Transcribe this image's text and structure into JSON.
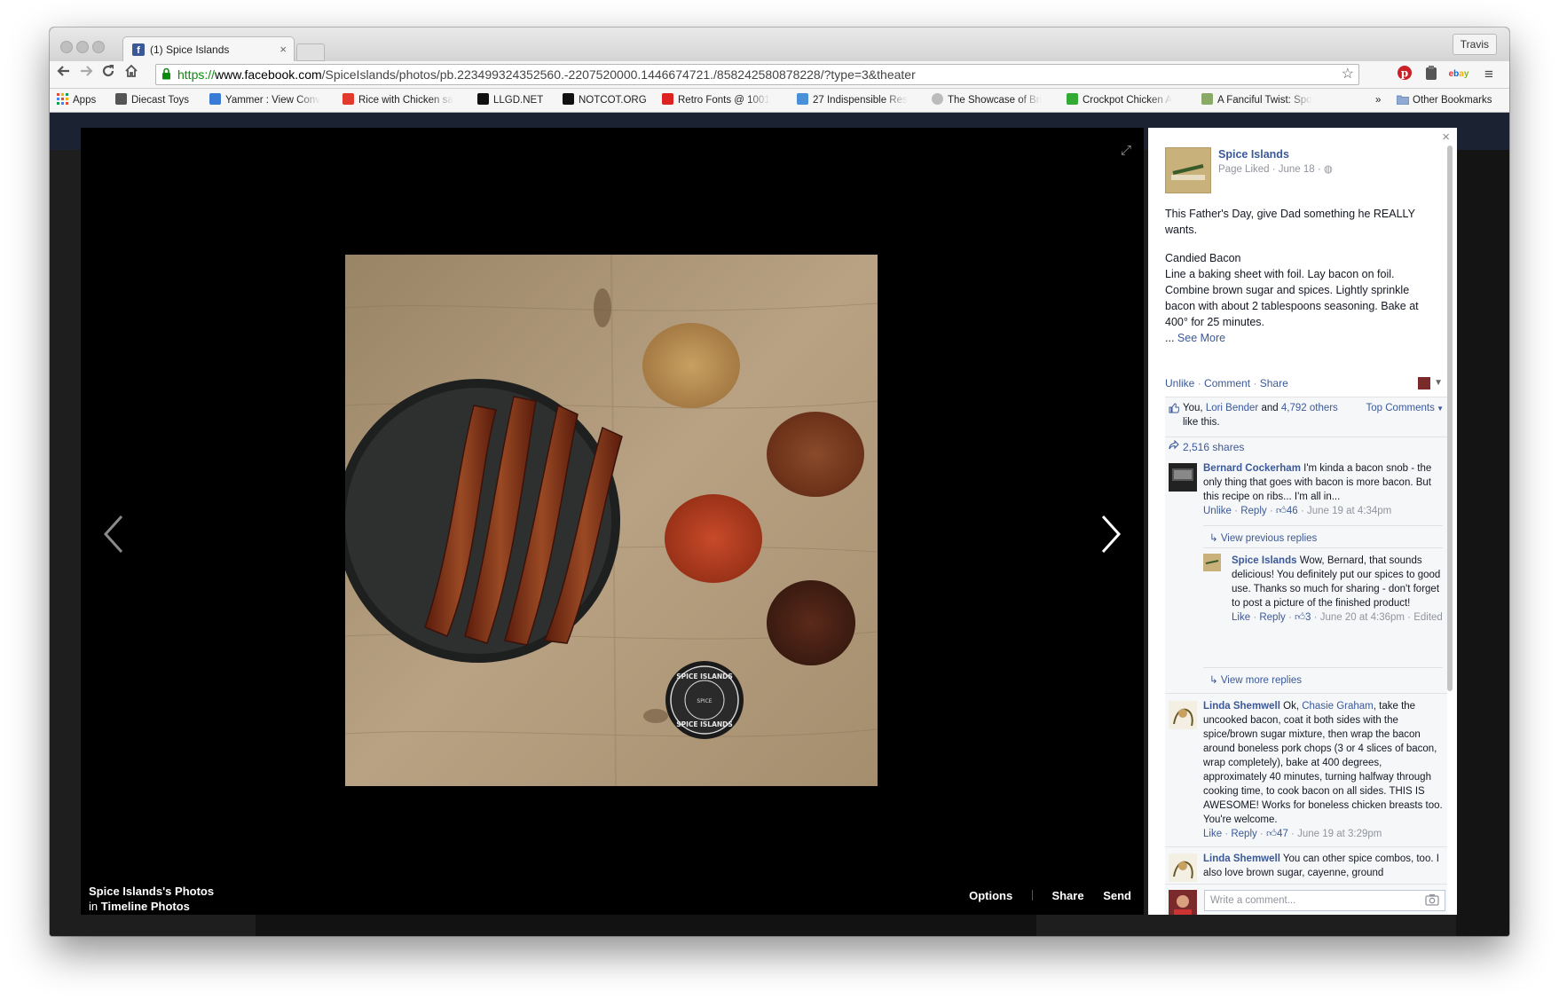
{
  "browser": {
    "tab_title": "(1) Spice Islands",
    "tab_favicon": "f",
    "tab_close": "×",
    "profile_name": "Travis",
    "url_scheme": "https://",
    "url_domain": "www.facebook.com",
    "url_path": "/SpiceIslands/photos/pb.223499324352560.-2207520000.1446674721./858242580878228/?type=3&theater",
    "bookmarks": [
      {
        "label": "Apps",
        "color": "#d44"
      },
      {
        "label": "Diecast Toys",
        "color": "#666"
      },
      {
        "label": "Yammer : View Conv",
        "color": "#3a7bd5"
      },
      {
        "label": "Rice with Chicken sa",
        "color": "#e23b2e"
      },
      {
        "label": "LLGD.NET",
        "color": "#111"
      },
      {
        "label": "NOTCOT.ORG",
        "color": "#111"
      },
      {
        "label": "Retro Fonts @ 1001",
        "color": "#d22"
      },
      {
        "label": "27 Indispensible Res",
        "color": "#4a90d9"
      },
      {
        "label": "The Showcase of Bri",
        "color": "#999"
      },
      {
        "label": "Crockpot Chicken A",
        "color": "#3a3"
      },
      {
        "label": "A Fanciful Twist: Spo",
        "color": "#8a6"
      }
    ],
    "bookmarks_more": "»",
    "other_bookmarks": "Other Bookmarks"
  },
  "viewer": {
    "album_title": "Spice Islands's Photos",
    "album_prefix": "in",
    "album_name": "Timeline Photos",
    "options_label": "Options",
    "share_label": "Share",
    "send_label": "Send",
    "tin_top": "SPICE ISLANDS",
    "tin_bottom": "SPICE ISLANDS",
    "tin_center": "SPICE",
    "colors": {
      "bacon": "#7a2e14",
      "plate": "#2e2f2f",
      "wood": "#b09a78"
    }
  },
  "panel": {
    "close_label": "×",
    "page_name": "Spice Islands",
    "page_meta": "Page Liked · June 18 ·",
    "post_line1": "This Father's Day, give Dad something he REALLY wants.",
    "post_recipe_title": "Candied Bacon",
    "post_recipe": "Line a baking sheet with foil. Lay bacon on foil. Combine brown sugar and spices. Lightly sprinkle bacon with about 2 tablespoons seasoning. Bake at 400° for 25 minutes.",
    "see_more_prefix": "...",
    "see_more": "See More",
    "unlike": "Unlike",
    "comment": "Comment",
    "share": "Share",
    "dot": "·",
    "likes_you": "You,",
    "likes_person": "Lori Bender",
    "likes_and": "and",
    "likes_others": "4,792 others",
    "likes_suffix": "like this.",
    "top_comments": "Top Comments",
    "shares": "2,516 shares",
    "comments": [
      {
        "name": "Bernard Cockerham",
        "text": "I'm kinda a bacon snob - the only thing that goes with bacon is more bacon. But this recipe on ribs... I'm all in...",
        "action1": "Unlike",
        "action2": "Reply",
        "likes": "46",
        "time": "June 19 at 4:34pm"
      },
      {
        "name": "Linda Shemwell",
        "prefix": "Ok,",
        "mention": "Chasie Graham",
        "text": ", take the uncooked bacon, coat it both sides with the spice/brown sugar mixture, then wrap the bacon around boneless pork chops (3 or 4 slices of bacon, wrap completely), bake at 400 degrees, approximately 40 minutes, turning halfway through cooking time, to cook bacon on all sides. THIS IS AWESOME! Works for boneless chicken breasts too. You're welcome.",
        "action1": "Like",
        "action2": "Reply",
        "likes": "47",
        "time": "June 19 at 3:29pm"
      },
      {
        "name": "Linda Shemwell",
        "text": "You can other spice combos, too. I also love brown sugar, cayenne, ground"
      }
    ],
    "view_previous": "View previous replies",
    "view_more": "View more replies",
    "reply": {
      "name": "Spice Islands",
      "text": "Wow, Bernard, that sounds delicious! You definitely put our spices to good use. Thanks so much for sharing - don't forget to post a picture of the finished product!",
      "action1": "Like",
      "action2": "Reply",
      "likes": "3",
      "time": "June 20 at 4:36pm",
      "edited": "Edited"
    },
    "write_placeholder": "Write a comment..."
  }
}
